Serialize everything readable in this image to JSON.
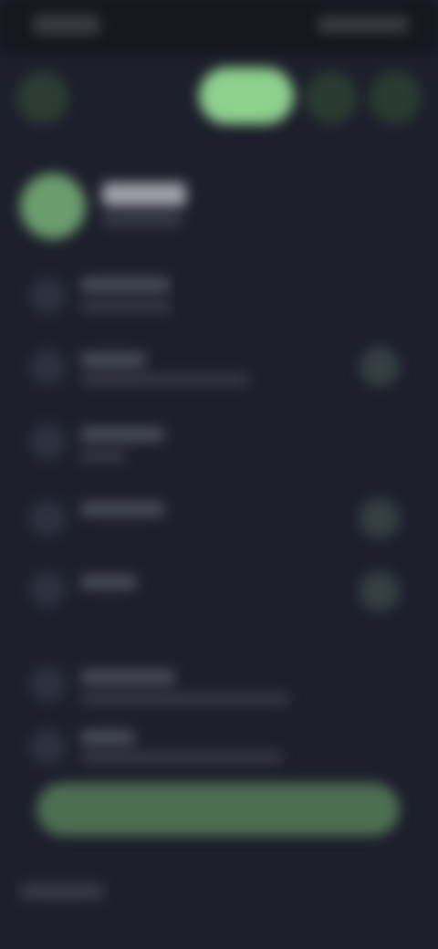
{
  "statusbar": {
    "time": "",
    "icons": ""
  },
  "toolbar": {
    "primary_label": "",
    "icons": [
      "back-icon",
      "more-icon",
      "share-icon"
    ]
  },
  "header": {
    "title": "",
    "subtitle": ""
  },
  "rows": [
    {
      "label": "",
      "sub": ""
    },
    {
      "label": "",
      "sub": ""
    },
    {
      "label": "",
      "sub": ""
    },
    {
      "label": "",
      "sub": ""
    },
    {
      "label": "",
      "sub": ""
    },
    {
      "label": "",
      "sub": ""
    },
    {
      "label": "",
      "sub": ""
    }
  ],
  "action_label": "",
  "footer_text": "",
  "colors": {
    "background": "#1d1f2b",
    "accent": "#8ed08e",
    "accent_dim": "#4e6e52"
  }
}
